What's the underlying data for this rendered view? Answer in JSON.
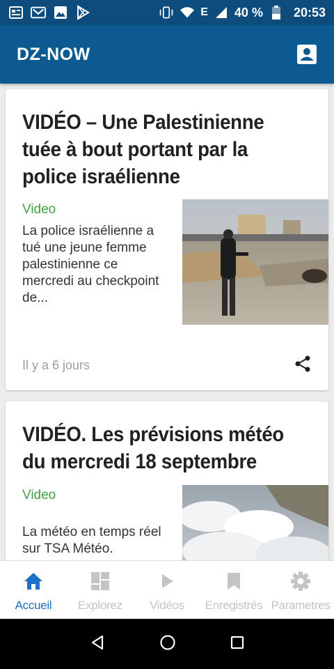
{
  "status_bar": {
    "battery": "40 %",
    "time": "20:53",
    "network": "E",
    "icons": [
      "news-icon",
      "gmail-icon",
      "gallery-icon",
      "play-store-icon",
      "vibrate-icon",
      "wifi-icon",
      "signal-icon",
      "battery-icon"
    ]
  },
  "app_bar": {
    "title": "DZ-NOW",
    "account_icon": "account-box-icon"
  },
  "articles": [
    {
      "title": "VIDÉO – Une Palestinienne tuée à bout portant par la police israélienne",
      "category": "Video",
      "excerpt": "La police israélienne a tué une jeune femme palestinienne ce mercredi au checkpoint de...",
      "time": "Il y a 6 jours",
      "share_icon": "share-icon"
    },
    {
      "title": "VIDÉO. Les prévisions météo du mercredi 18 septembre",
      "category": "Video",
      "excerpt": "La météo en temps réel sur TSA Météo."
    }
  ],
  "bottom_nav": {
    "items": [
      {
        "label": "Accueil",
        "icon": "home-icon",
        "active": true
      },
      {
        "label": "Explorez",
        "icon": "dashboard-icon",
        "active": false
      },
      {
        "label": "Vidéos",
        "icon": "play-icon",
        "active": false
      },
      {
        "label": "Enregistrés",
        "icon": "bookmark-icon",
        "active": false
      },
      {
        "label": "Parametres",
        "icon": "settings-icon",
        "active": false
      }
    ]
  },
  "colors": {
    "status_bar": "#0d4c7d",
    "app_bar": "#0d5a90",
    "category": "#43a047",
    "nav_active": "#1e6fc7",
    "nav_inactive": "#c4c4c4"
  }
}
